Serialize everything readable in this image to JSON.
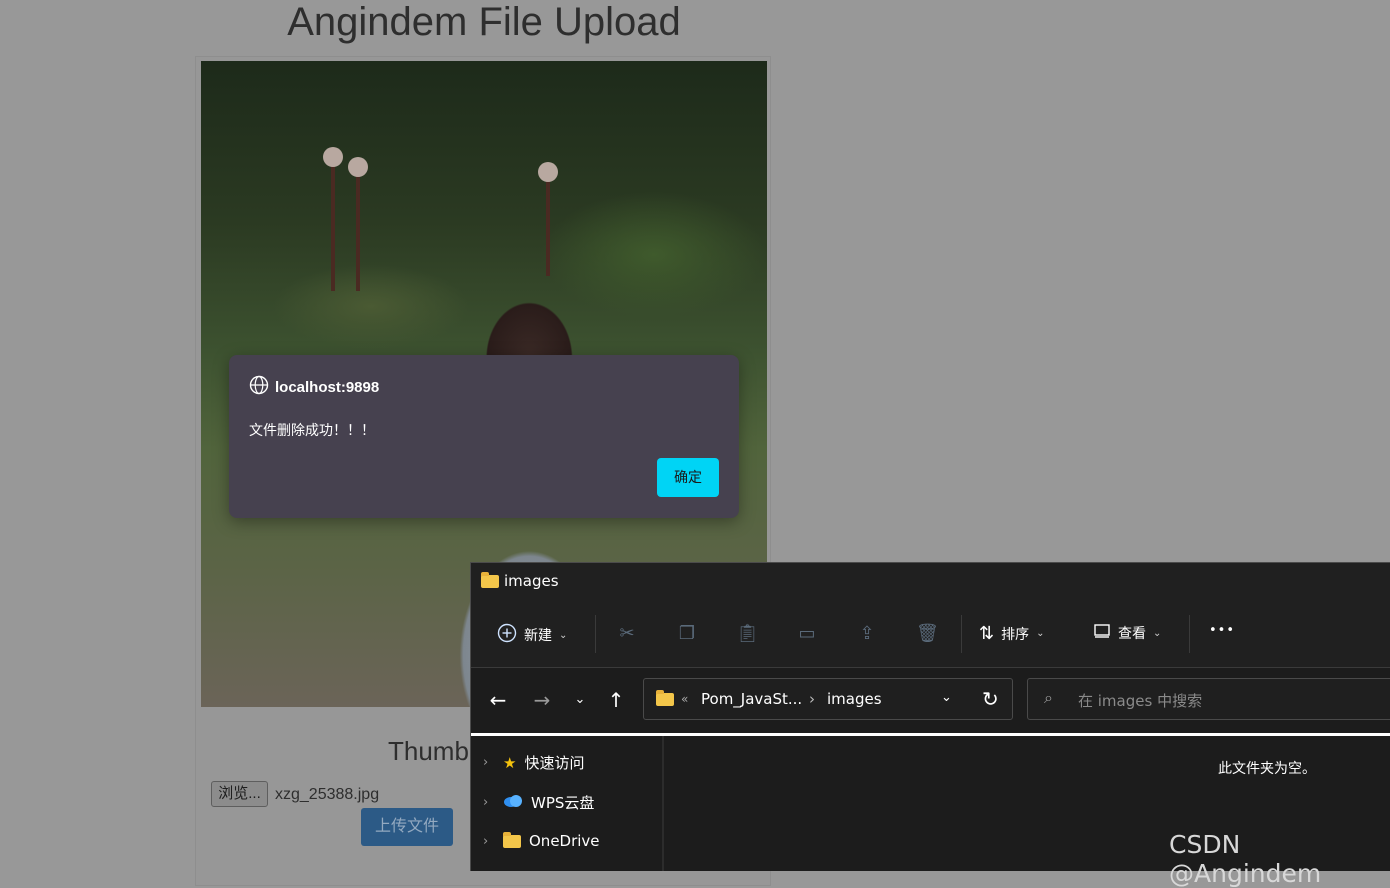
{
  "page": {
    "title": "Angindem File Upload",
    "caption": "Thumb",
    "browse_label": "浏览...",
    "file_name": "xzg_25388.jpg",
    "upload_label": "上传文件"
  },
  "dialog": {
    "origin": "localhost:9898",
    "message": "文件删除成功！！！",
    "ok_label": "确定",
    "ok_color": "#00d4f5"
  },
  "explorer": {
    "title": "images",
    "toolbar": {
      "new_label": "新建",
      "sort_label": "排序",
      "view_label": "查看",
      "more_label": "•••"
    },
    "address": {
      "overflow": "«",
      "parent": "Pom_JavaSt...",
      "separator": "›",
      "current": "images"
    },
    "search_placeholder": "在 images 中搜索",
    "sidebar": [
      {
        "label": "快速访问",
        "icon": "star-icon"
      },
      {
        "label": "WPS云盘",
        "icon": "cloud-icon"
      },
      {
        "label": "OneDrive",
        "icon": "folder-icon"
      }
    ],
    "empty_message": "此文件夹为空。"
  },
  "watermark": "CSDN @Angindem"
}
